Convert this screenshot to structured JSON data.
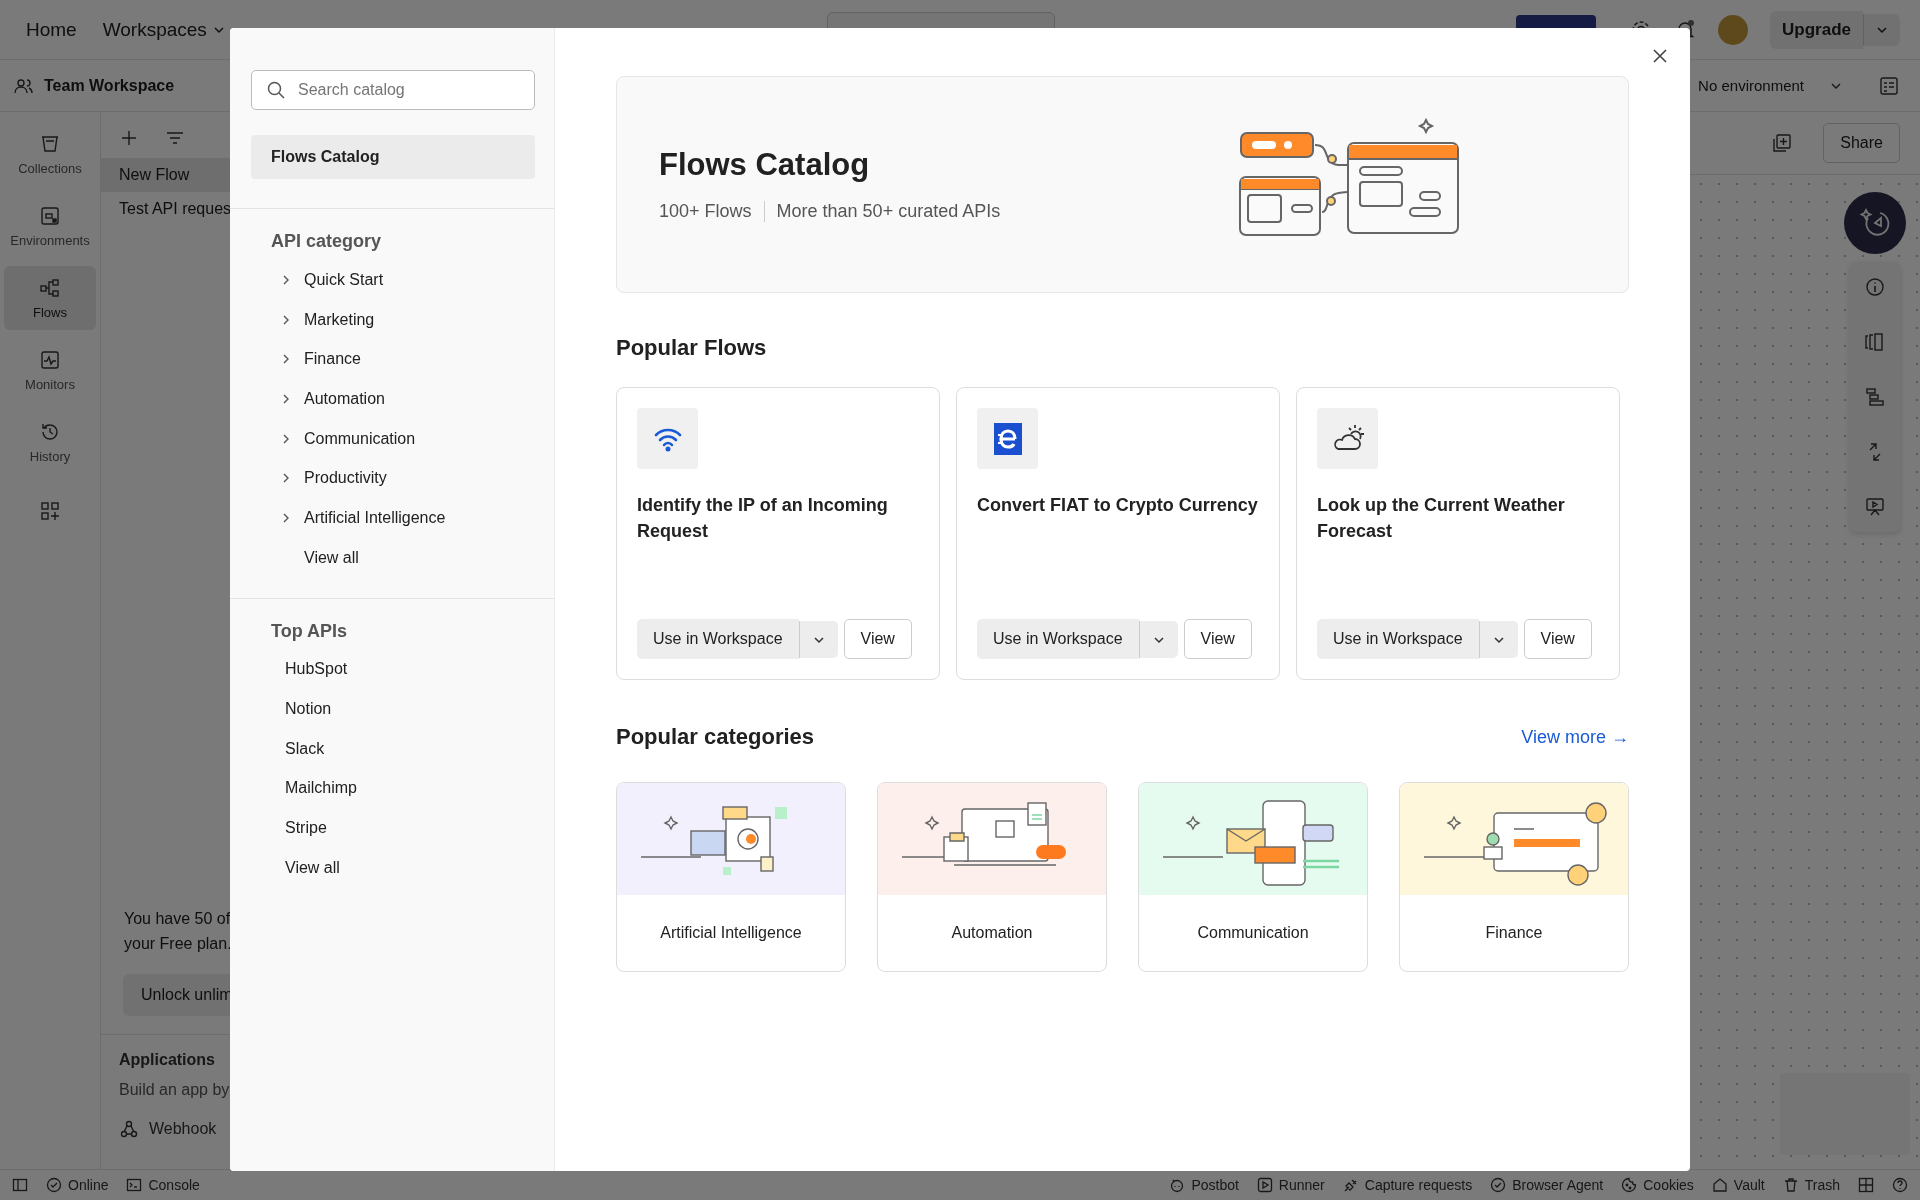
{
  "top_bar": {
    "nav": [
      "Home",
      "Workspaces"
    ],
    "upgrade": "Upgrade"
  },
  "workspace_bar": {
    "name": "Team Workspace",
    "environment": "No environment"
  },
  "rail": [
    {
      "label": "Collections",
      "selected": false
    },
    {
      "label": "Environments",
      "selected": false
    },
    {
      "label": "Flows",
      "selected": true
    },
    {
      "label": "Monitors",
      "selected": false
    },
    {
      "label": "History",
      "selected": false
    }
  ],
  "flows_panel": {
    "items": [
      {
        "label": "New Flow",
        "selected": true
      },
      {
        "label": "Test API reques",
        "selected": false
      }
    ],
    "notice": [
      "You have 50 of",
      "your Free plan."
    ],
    "unlock_button": "Unlock unlim",
    "applications": {
      "title": "Applications",
      "text": "Build an app by",
      "item": "Webhook"
    }
  },
  "canvas": {
    "share": "Share"
  },
  "status_bar": {
    "left": [
      "Online",
      "Console"
    ],
    "right": [
      "Postbot",
      "Runner",
      "Capture requests",
      "Browser Agent",
      "Cookies",
      "Vault",
      "Trash"
    ]
  },
  "modal": {
    "search": {
      "placeholder": "Search catalog"
    },
    "nav_item": {
      "label": "Flows Catalog",
      "selected": true
    },
    "api_category": {
      "title": "API category",
      "items": [
        {
          "label": "Quick Start",
          "expanded": false
        },
        {
          "label": "Marketing",
          "expanded": false
        },
        {
          "label": "Finance",
          "expanded": false
        },
        {
          "label": "Automation",
          "expanded": false
        },
        {
          "label": "Communication",
          "expanded": false
        },
        {
          "label": "Productivity",
          "expanded": false
        },
        {
          "label": "Artificial Intelligence",
          "expanded": false
        }
      ],
      "view_all": "View all"
    },
    "top_apis": {
      "title": "Top APIs",
      "items": [
        "HubSpot",
        "Notion",
        "Slack",
        "Mailchimp",
        "Stripe"
      ],
      "view_all": "View all"
    },
    "hero": {
      "title": "Flows Catalog",
      "stats": [
        "100+ Flows",
        "More than 50+ curated APIs"
      ]
    },
    "popular_flows": {
      "title": "Popular Flows",
      "cards": [
        {
          "title": "Identify the IP of an Incoming Request",
          "primary": "Use in Workspace",
          "secondary": "View"
        },
        {
          "title": "Convert FIAT to Crypto Currency",
          "primary": "Use in Workspace",
          "secondary": "View"
        },
        {
          "title": "Look up the Current Weather Forecast",
          "primary": "Use in Workspace",
          "secondary": "View"
        }
      ]
    },
    "popular_categories": {
      "title": "Popular categories",
      "view_more": "View more →",
      "cards": [
        {
          "label": "Artificial Intelligence",
          "color": "#f3f0fd"
        },
        {
          "label": "Automation",
          "color": "#fdefeb"
        },
        {
          "label": "Communication",
          "color": "#e6fbef"
        },
        {
          "label": "Finance",
          "color": "#fff7dc"
        }
      ]
    }
  }
}
